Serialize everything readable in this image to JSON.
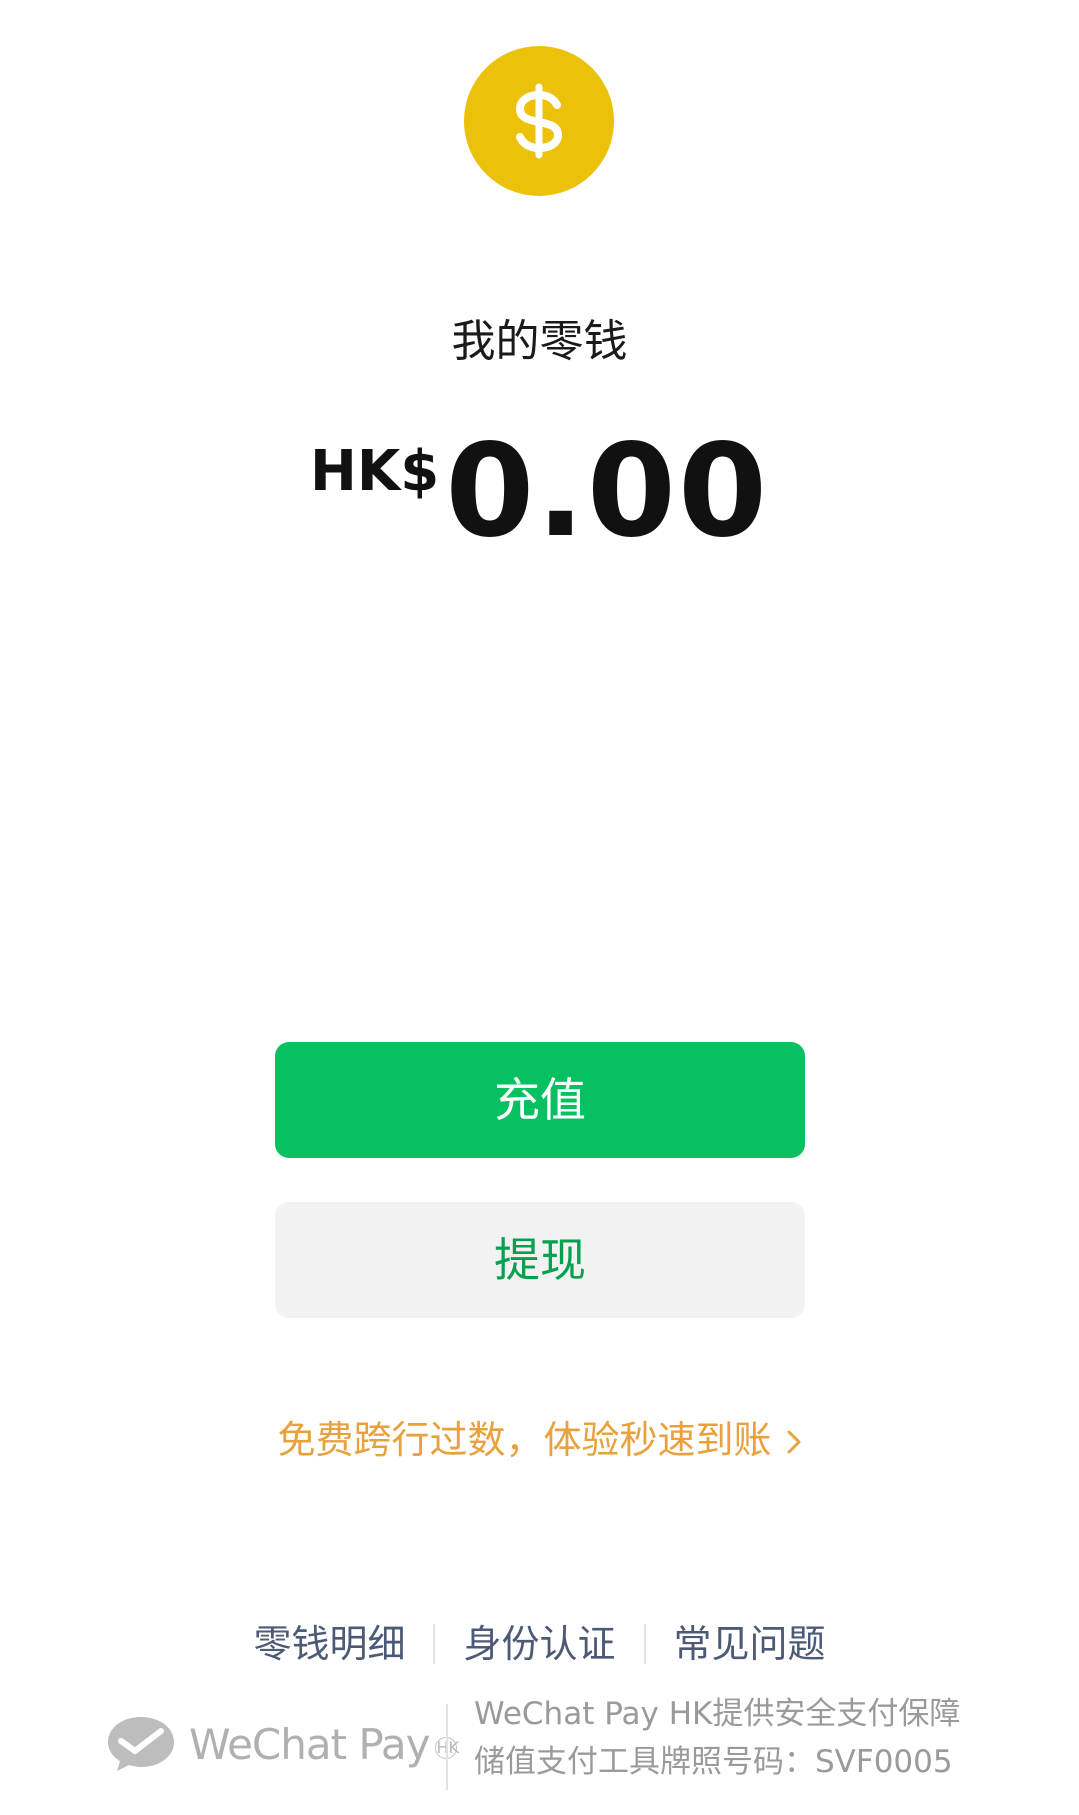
{
  "page": {
    "title": "我的零钱"
  },
  "balance": {
    "currency": "HK$",
    "amount": "0.00"
  },
  "actions": {
    "top_up_label": "充值",
    "withdraw_label": "提现"
  },
  "promo": {
    "text": "免费跨行过数，体验秒速到账"
  },
  "links": [
    {
      "label": "零钱明细"
    },
    {
      "label": "身份认证"
    },
    {
      "label": "常见问题"
    }
  ],
  "footer": {
    "brand_name": "WeChat Pay",
    "brand_mark": "HK",
    "line1": "WeChat Pay HK提供安全支付保障",
    "line2": "储值支付工具牌照号码：SVF0005"
  },
  "colors": {
    "coin": "#EBC10A",
    "primary_button": "#07C160",
    "secondary_button": "#F2F2F2",
    "secondary_text": "#07A04F",
    "promo": "#E8A13C",
    "link": "#4D5A75"
  },
  "icons": {
    "coin": "dollar-coin-icon",
    "promo_arrow": "chevron-right-icon",
    "brand_logo": "wechat-pay-logo-icon"
  }
}
